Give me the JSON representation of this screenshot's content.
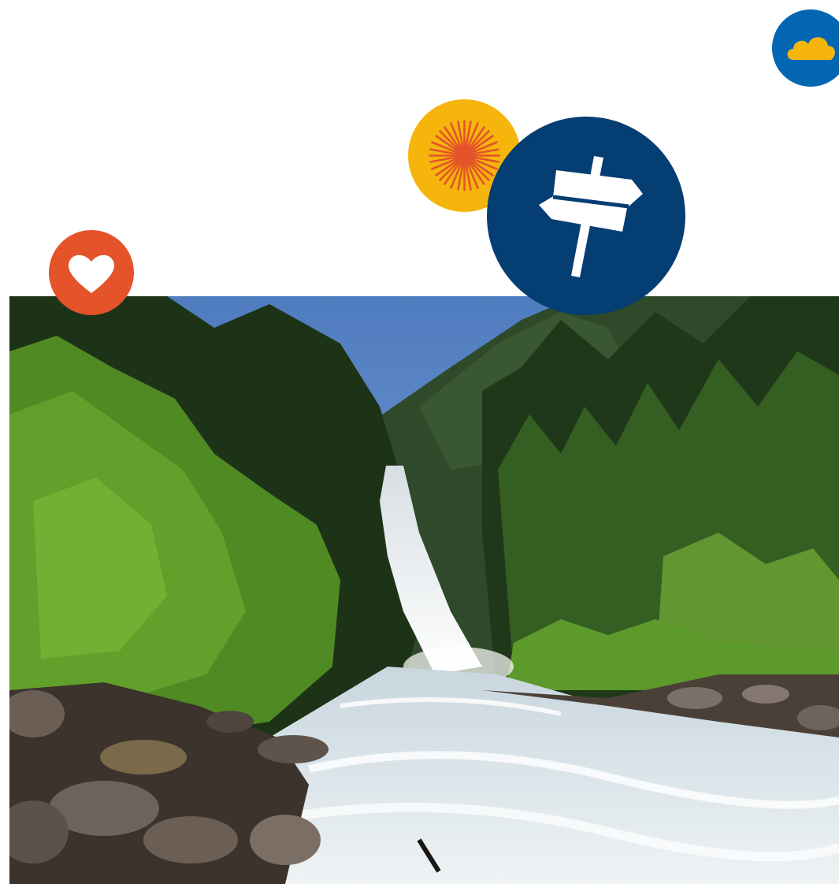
{
  "colors": {
    "heart_badge": "#e4532a",
    "sun_badge": "#f5b50c",
    "sun_rays": "#e4532a",
    "signpost_badge": "#053e72",
    "cloud_badge": "#0366b3",
    "cloud": "#f5b50c",
    "icon_white": "#ffffff",
    "sky": "#5d86c4",
    "forest_dark": "#1d3317",
    "forest_light": "#4f8a23",
    "water": "#e8eef2",
    "rock": "#5b5048"
  },
  "icons": {
    "heart": "heart-icon",
    "sun": "sun-icon",
    "signpost": "signpost-icon",
    "cloud": "cloud-icon"
  },
  "photo": {
    "subject": "waterfall-forest-river-photo"
  }
}
